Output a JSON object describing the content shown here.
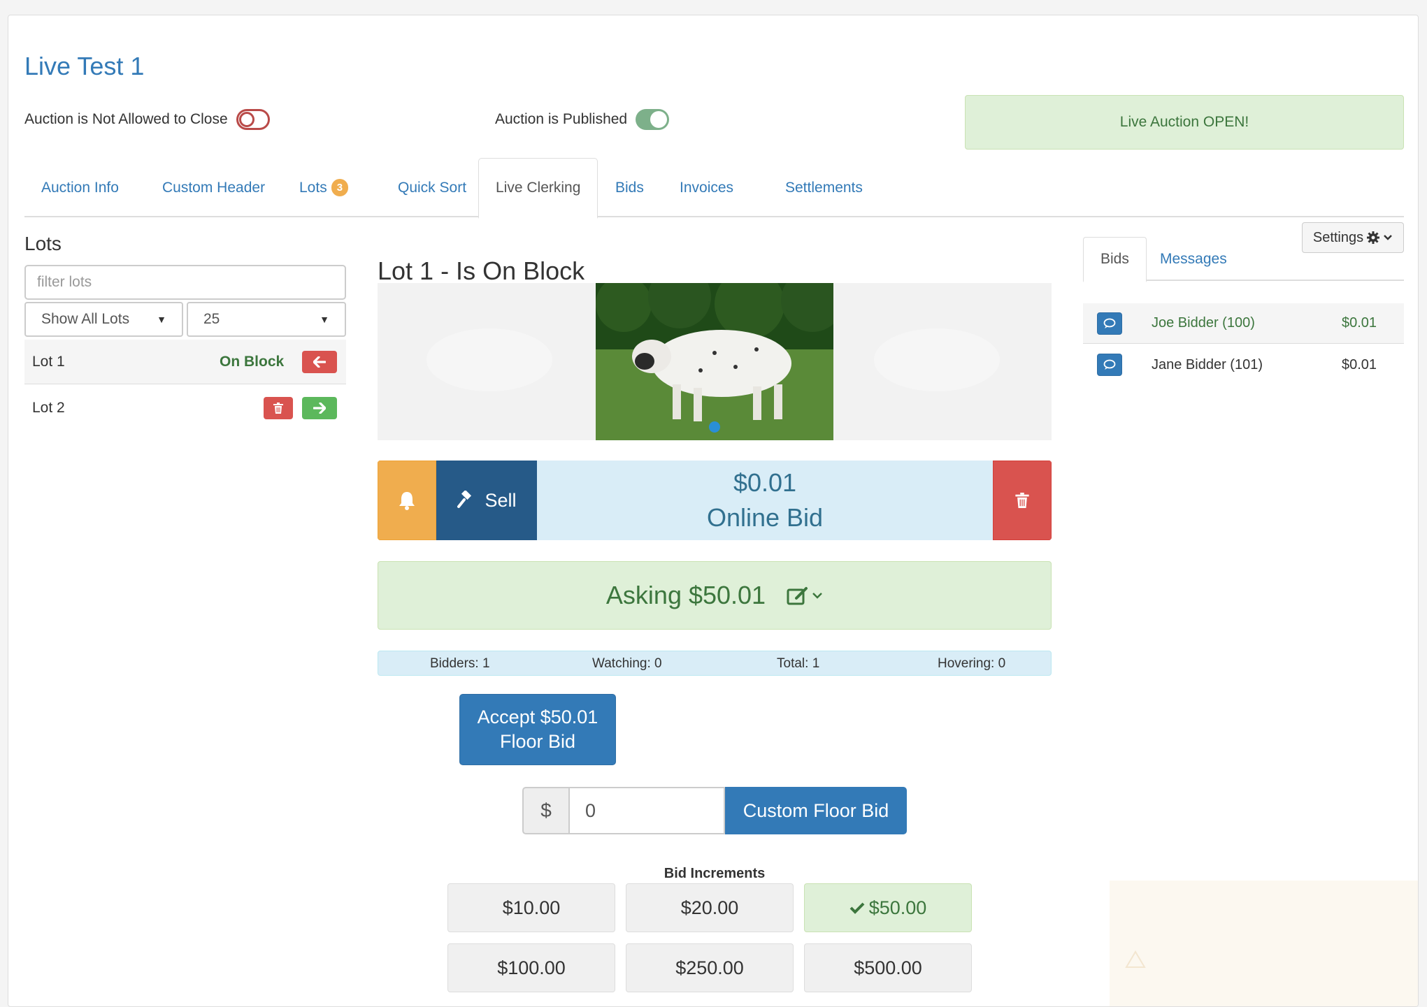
{
  "auction": {
    "title": "Live Test 1",
    "close_label": "Auction is Not Allowed to Close",
    "close_toggle": false,
    "publish_label": "Auction is Published",
    "publish_toggle": true,
    "status": "Live Auction OPEN!"
  },
  "tabs": [
    {
      "label": "Auction Info"
    },
    {
      "label": "Custom Header"
    },
    {
      "label": "Lots",
      "badge": "3"
    },
    {
      "label": "Quick Sort"
    },
    {
      "label": "Live Clerking",
      "active": true
    },
    {
      "label": "Bids"
    },
    {
      "label": "Invoices"
    },
    {
      "label": "Settlements"
    }
  ],
  "lots_panel": {
    "heading": "Lots",
    "filter_placeholder": "filter lots",
    "show_select": "Show All Lots",
    "page_size_select": "25",
    "lots": [
      {
        "name": "Lot 1",
        "status": "On Block"
      },
      {
        "name": "Lot 2",
        "status": ""
      }
    ]
  },
  "block": {
    "heading": "Lot 1 - Is On Block",
    "sell_label": "Sell",
    "current_bid": "$0.01",
    "bid_type": "Online Bid",
    "asking": "Asking $50.01"
  },
  "stats": {
    "bidders": "Bidders: 1",
    "watching": "Watching: 0",
    "total": "Total: 1",
    "hovering": "Hovering: 0"
  },
  "accept": {
    "line1": "Accept $50.01",
    "line2": "Floor Bid"
  },
  "custom_bid": {
    "currency": "$",
    "value": "0",
    "button": "Custom Floor Bid"
  },
  "increments": {
    "label": "Bid Increments",
    "items": [
      "$10.00",
      "$20.00",
      "$50.00",
      "$100.00",
      "$250.00",
      "$500.00"
    ],
    "selected": "$50.00"
  },
  "right_panel": {
    "settings_label": "Settings",
    "tabs": [
      "Bids",
      "Messages"
    ],
    "bids": [
      {
        "bidder": "Joe Bidder (100)",
        "amount": "$0.01"
      },
      {
        "bidder": "Jane Bidder (101)",
        "amount": "$0.01"
      }
    ]
  },
  "colors": {
    "primary": "#337ab7",
    "success_bg": "#dff0d8",
    "success_text": "#3c763d",
    "danger": "#d9534f",
    "warning": "#f0ad4e",
    "sell": "#265a88",
    "info_bg": "#d9edf7"
  },
  "icons": [
    "bell-icon",
    "gavel-icon",
    "trash-icon",
    "arrow-left-icon",
    "arrow-right-icon",
    "edit-icon",
    "chevron-down-icon",
    "gear-icon",
    "comment-icon",
    "check-icon"
  ]
}
